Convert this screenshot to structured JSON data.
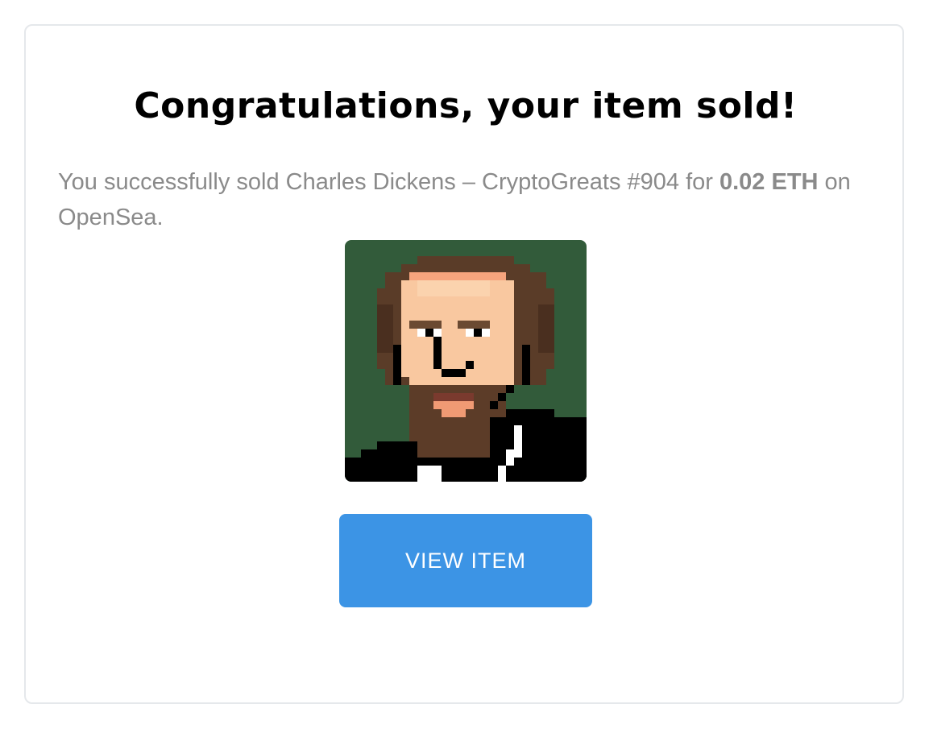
{
  "dialog": {
    "title": "Congratulations, your item sold!",
    "message": {
      "prefix": "You successfully sold Charles Dickens – CryptoGreats #904 for ",
      "price": "0.02 ETH",
      "suffix": " on OpenSea."
    },
    "nft": {
      "image_icon": "pixel-art-portrait-charles-dickens",
      "background_color": "#325b3a"
    },
    "view_button_label": "VIEW ITEM"
  },
  "colors": {
    "button": "#3c94e5",
    "message_text": "#8a8a8a",
    "card_border": "#e5e8eb"
  }
}
